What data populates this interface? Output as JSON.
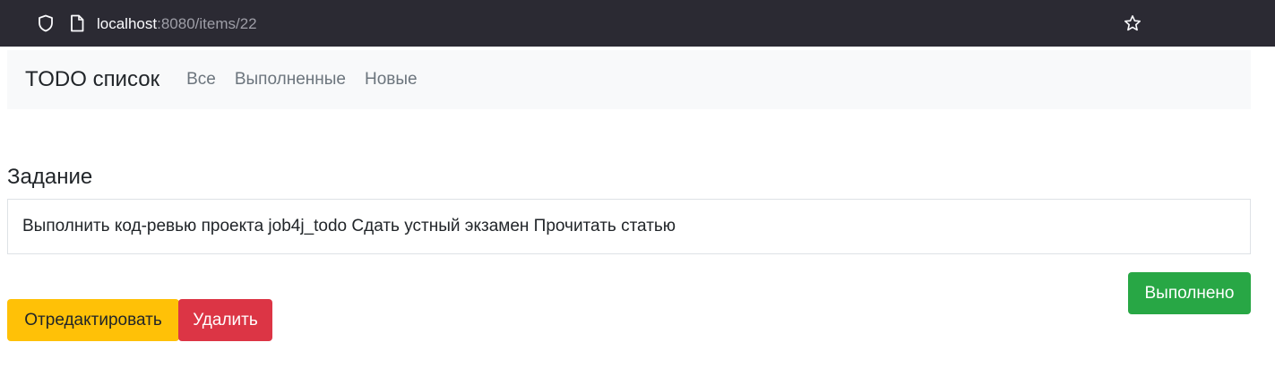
{
  "browser": {
    "url_host": "localhost",
    "url_path": ":8080/items/22",
    "icons": [
      "shield-icon",
      "page-icon",
      "star-icon"
    ],
    "chrome_color": "#2b2a33"
  },
  "navbar": {
    "brand": "TODO список",
    "links": [
      "Все",
      "Выполненные",
      "Новые"
    ]
  },
  "task": {
    "label": "Задание",
    "description": "Выполнить код-ревью проекта job4j_todo Сдать устный экзамен Прочитать статью"
  },
  "actions": {
    "done_label": "Выполнено",
    "edit_label": "Отредактировать",
    "delete_label": "Удалить"
  },
  "colors": {
    "success": "#28a745",
    "warning": "#ffc107",
    "danger": "#dc3545",
    "navbar_bg": "#f8f9fa"
  }
}
